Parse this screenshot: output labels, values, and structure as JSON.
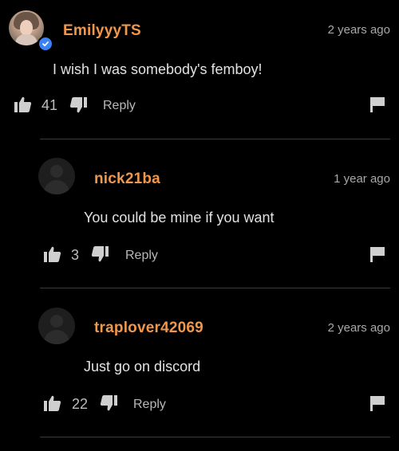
{
  "comments": [
    {
      "username": "EmilyyyTS",
      "time": "2 years ago",
      "text": "I wish I was somebody's femboy!",
      "likes": "41",
      "reply_label": "Reply",
      "verified": true,
      "avatar": "profile-photo"
    },
    {
      "username": "nick21ba",
      "time": "1 year ago",
      "text": "You could be mine if you want",
      "likes": "3",
      "reply_label": "Reply",
      "avatar": "default-avatar-icon"
    },
    {
      "username": "traplover42069",
      "time": "2 years ago",
      "text": "Just go on discord",
      "likes": "22",
      "reply_label": "Reply",
      "avatar": "default-avatar-icon"
    }
  ],
  "colors": {
    "background": "#000000",
    "username": "#f0974b",
    "verified_badge": "#3b82f6",
    "divider": "#3a3a3a"
  }
}
